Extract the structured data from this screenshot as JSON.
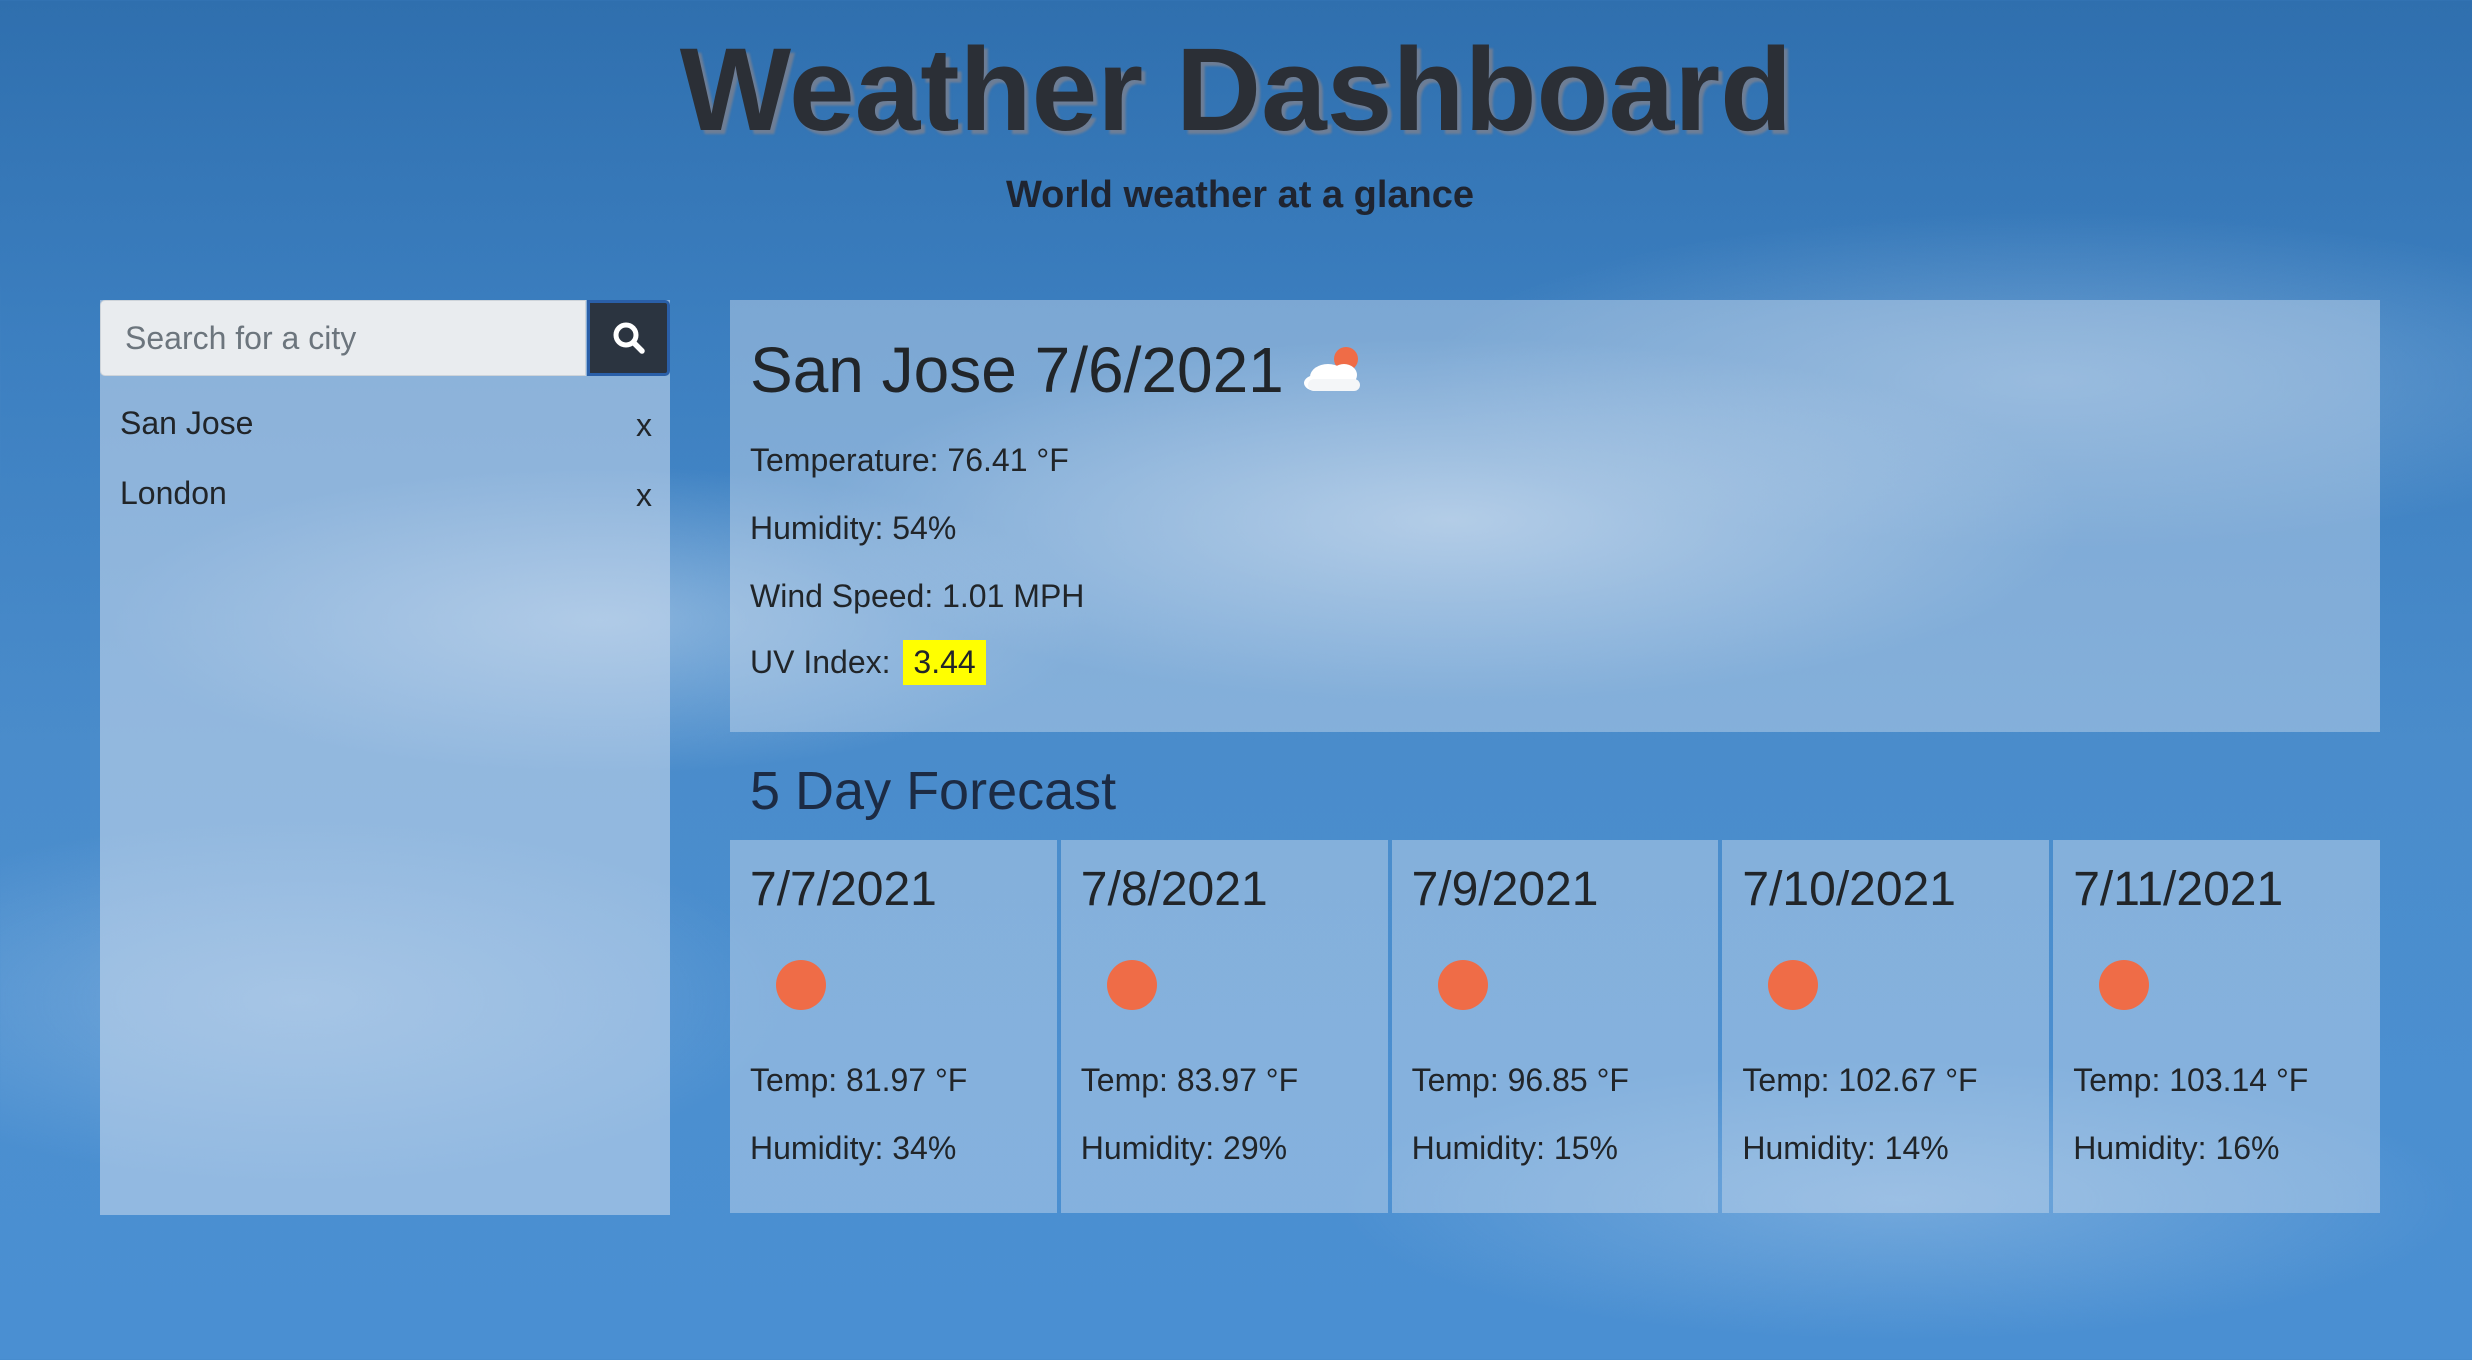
{
  "header": {
    "title": "Weather Dashboard",
    "subtitle": "World weather at a glance"
  },
  "search": {
    "placeholder": "Search for a city",
    "value": "",
    "button_icon": "search-icon"
  },
  "history": {
    "remove_label": "x",
    "cities": [
      {
        "name": "San Jose"
      },
      {
        "name": "London"
      }
    ]
  },
  "current": {
    "heading": "San Jose 7/6/2021",
    "icon": "partly-cloudy-icon",
    "temperature": "Temperature: 76.41 °F",
    "humidity": "Humidity: 54%",
    "wind": "Wind Speed: 1.01 MPH",
    "uv_label": "UV Index:",
    "uv_value": "3.44",
    "uv_color": "#ffff00"
  },
  "forecast": {
    "title": "5 Day Forecast",
    "icon": "sun-icon",
    "icon_color": "#ef6c47",
    "days": [
      {
        "date": "7/7/2021",
        "temp": "Temp: 81.97 °F",
        "humidity": "Humidity: 34%"
      },
      {
        "date": "7/8/2021",
        "temp": "Temp: 83.97 °F",
        "humidity": "Humidity: 29%"
      },
      {
        "date": "7/9/2021",
        "temp": "Temp: 96.85 °F",
        "humidity": "Humidity: 15%"
      },
      {
        "date": "7/10/2021",
        "temp": "Temp: 102.67 °F",
        "humidity": "Humidity: 14%"
      },
      {
        "date": "7/11/2021",
        "temp": "Temp: 103.14 °F",
        "humidity": "Humidity: 16%"
      }
    ]
  }
}
